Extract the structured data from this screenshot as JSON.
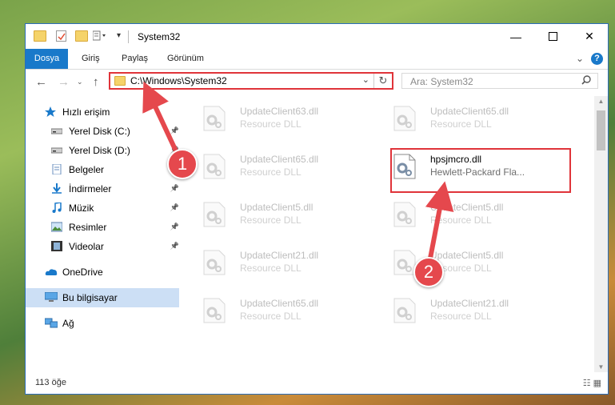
{
  "window": {
    "title": "System32"
  },
  "ribbon": {
    "tabs": [
      "Dosya",
      "Giriş",
      "Paylaş",
      "Görünüm"
    ],
    "help": "?"
  },
  "address": {
    "path": "C:\\Windows\\System32",
    "search_placeholder": "Ara: System32"
  },
  "sidebar": {
    "items": [
      {
        "label": "Hızlı erişim",
        "icon": "star-icon"
      },
      {
        "label": "Yerel Disk (C:)",
        "icon": "drive-icon",
        "pinned": true
      },
      {
        "label": "Yerel Disk (D:)",
        "icon": "drive-icon",
        "pinned": true
      },
      {
        "label": "Belgeler",
        "icon": "documents-icon",
        "pinned": true
      },
      {
        "label": "İndirmeler",
        "icon": "download-icon",
        "pinned": true
      },
      {
        "label": "Müzik",
        "icon": "music-icon",
        "pinned": true
      },
      {
        "label": "Resimler",
        "icon": "pictures-icon",
        "pinned": true
      },
      {
        "label": "Videolar",
        "icon": "videos-icon",
        "pinned": true
      },
      {
        "label": "OneDrive",
        "icon": "onedrive-icon"
      },
      {
        "label": "Bu bilgisayar",
        "icon": "computer-icon",
        "selected": true
      },
      {
        "label": "Ağ",
        "icon": "network-icon"
      }
    ]
  },
  "files": [
    {
      "name": "UpdateClient63.dll",
      "desc": "Resource DLL"
    },
    {
      "name": "UpdateClient65.dll",
      "desc": "Resource DLL"
    },
    {
      "name": "UpdateClient65.dll",
      "desc": "Resource DLL"
    },
    {
      "name": "hpsjmcro.dll",
      "desc": "Hewlett-Packard Fla...",
      "highlighted": true
    },
    {
      "name": "UpdateClient5.dll",
      "desc": "Resource DLL"
    },
    {
      "name": "UpdateClient5.dll",
      "desc": "Resource DLL"
    },
    {
      "name": "UpdateClient21.dll",
      "desc": "Resource DLL"
    },
    {
      "name": "UpdateClient5.dll",
      "desc": "Resource DLL"
    },
    {
      "name": "UpdateClient65.dll",
      "desc": "Resource DLL"
    },
    {
      "name": "UpdateClient21.dll",
      "desc": "Resource DLL"
    }
  ],
  "status": {
    "count": "113 öğe"
  },
  "callouts": {
    "one": "1",
    "two": "2"
  },
  "colors": {
    "accent": "#1979ca",
    "highlight": "#e0343a",
    "callout": "#e5484d"
  }
}
